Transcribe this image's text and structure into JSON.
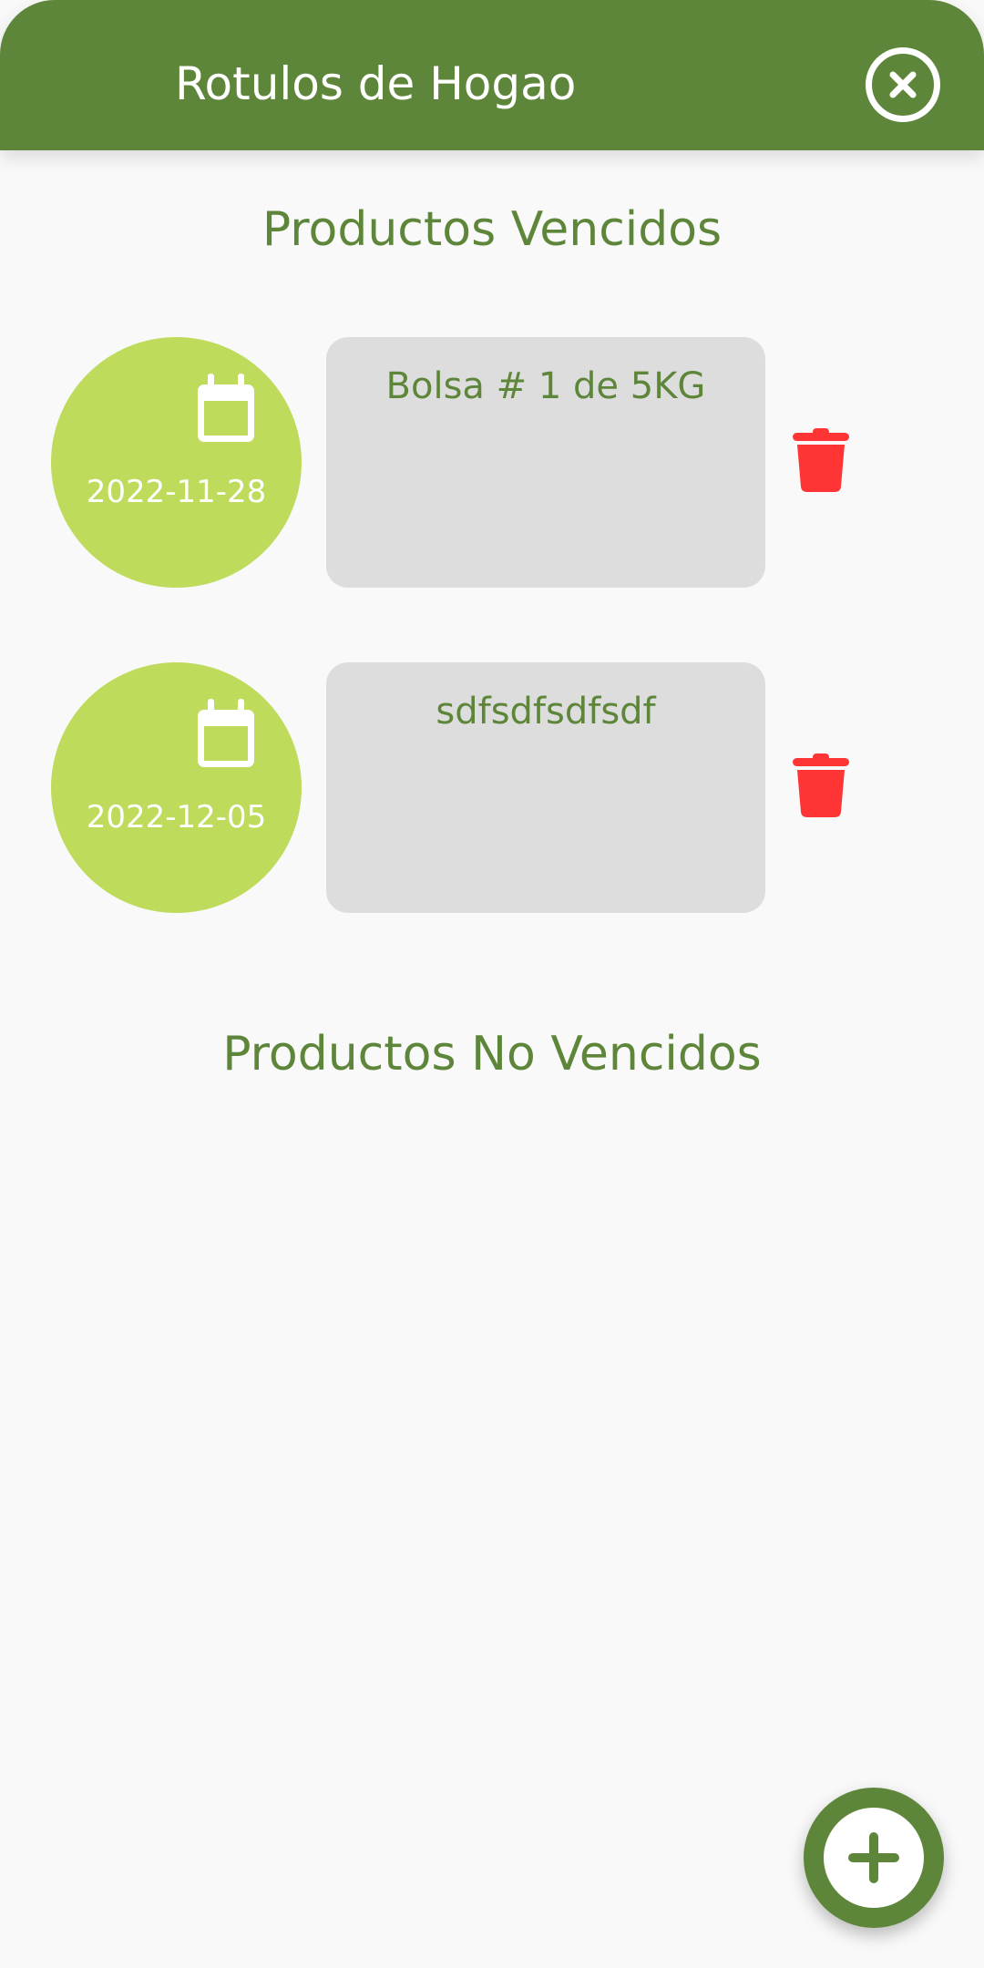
{
  "header": {
    "title": "Rotulos de Hogao",
    "close_icon": "close-circle-icon"
  },
  "sections": {
    "expired_title": "Productos Vencidos",
    "not_expired_title": "Productos No Vencidos"
  },
  "expired_items": [
    {
      "date": "2022-11-28",
      "note": "Bolsa # 1 de 5KG",
      "date_icon": "calendar-icon",
      "delete_icon": "trash-icon"
    },
    {
      "date": "2022-12-05",
      "note": "sdfsdfsdfsdf",
      "date_icon": "calendar-icon",
      "delete_icon": "trash-icon"
    }
  ],
  "fab": {
    "icon": "plus-icon"
  },
  "colors": {
    "primary": "#5e863a",
    "accent": "#bedb5b",
    "danger": "#ff3535",
    "card": "#dddddd",
    "background": "#f9f9f9"
  }
}
